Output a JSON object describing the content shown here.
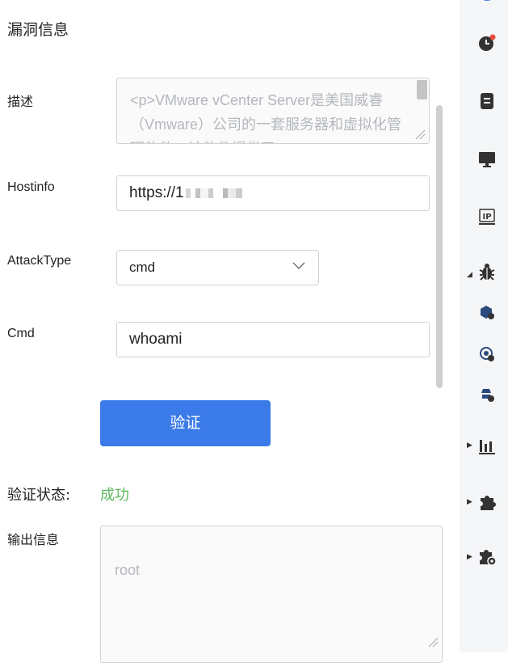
{
  "page": {
    "title": "漏洞信息"
  },
  "form": {
    "desc_label": "描述",
    "desc_value": "<p>VMware vCenter Server是美国威睿（Vmware）公司的一套服务器和虚拟化管理软件。该软件提供了",
    "hostinfo_label": "Hostinfo",
    "hostinfo_value": "https://1",
    "attacktype_label": "AttackType",
    "attacktype_value": "cmd",
    "cmd_label": "Cmd",
    "cmd_value": "whoami",
    "verify_button": "验证"
  },
  "result": {
    "status_label": "验证状态:",
    "status_value": "成功",
    "status_color": "#5cb85c",
    "output_label": "输出信息",
    "output_value": "root"
  },
  "sidebar": {
    "items": [
      {
        "icon": "clock-icon"
      },
      {
        "icon": "document-icon"
      },
      {
        "icon": "monitor-icon"
      },
      {
        "icon": "ip-icon",
        "text": "IP"
      },
      {
        "icon": "bug-icon"
      },
      {
        "icon": "package-bug-icon"
      },
      {
        "icon": "target-bug-icon"
      },
      {
        "icon": "spy-bug-icon"
      },
      {
        "icon": "bar-chart-icon"
      },
      {
        "icon": "puzzle-icon"
      },
      {
        "icon": "puzzle-settings-icon"
      }
    ]
  },
  "colors": {
    "accent": "#3b7be9",
    "success": "#5cb85c",
    "badge": "#e74c3c"
  }
}
